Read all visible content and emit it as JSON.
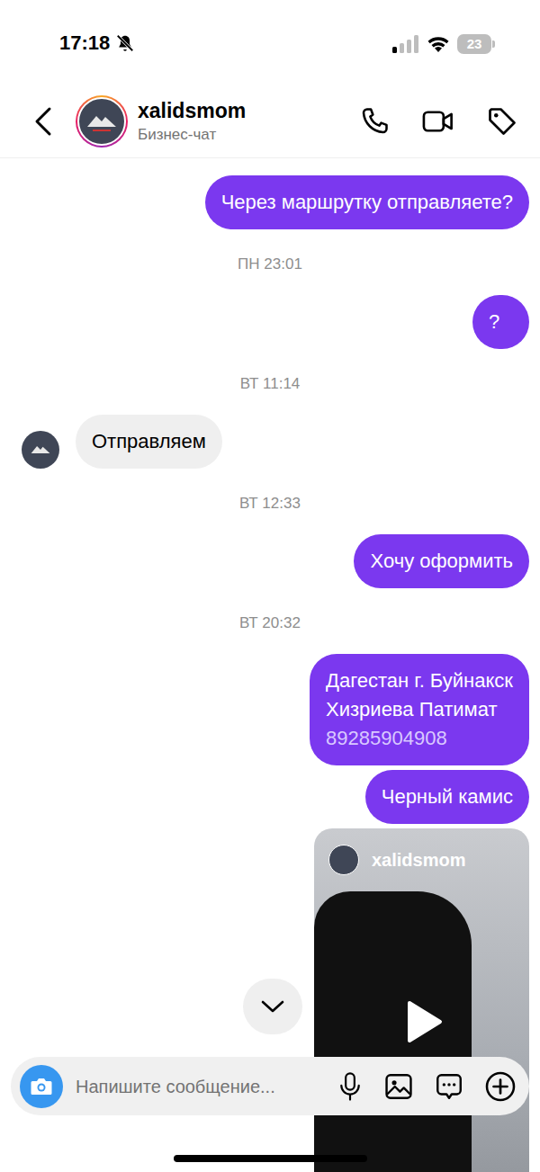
{
  "status_bar": {
    "time": "17:18",
    "battery": "23"
  },
  "header": {
    "name": "xalidsmom",
    "subtitle": "Бизнес-чат"
  },
  "messages": [
    {
      "kind": "partial"
    },
    {
      "kind": "outgoing",
      "lines": [
        "Через маршрутку отправляете?"
      ]
    },
    {
      "kind": "timestamp",
      "text": "ПН 23:01"
    },
    {
      "kind": "outgoing",
      "lines": [
        "?"
      ]
    },
    {
      "kind": "timestamp",
      "text": "ВТ 11:14"
    },
    {
      "kind": "incoming",
      "lines": [
        "Отправляем"
      ]
    },
    {
      "kind": "timestamp",
      "text": "ВТ 12:33"
    },
    {
      "kind": "outgoing",
      "lines": [
        "Хочу оформить"
      ]
    },
    {
      "kind": "timestamp",
      "text": "ВТ 20:32"
    },
    {
      "kind": "outgoing",
      "lines": [
        "Дагестан г. Буйнакск",
        "Хизриева Патимат"
      ],
      "link": "89285904908"
    },
    {
      "kind": "outgoing",
      "lines": [
        "Черный камис"
      ]
    },
    {
      "kind": "shared-video",
      "account": "xalidsmom"
    }
  ],
  "composer": {
    "placeholder": "Напишите сообщение..."
  }
}
